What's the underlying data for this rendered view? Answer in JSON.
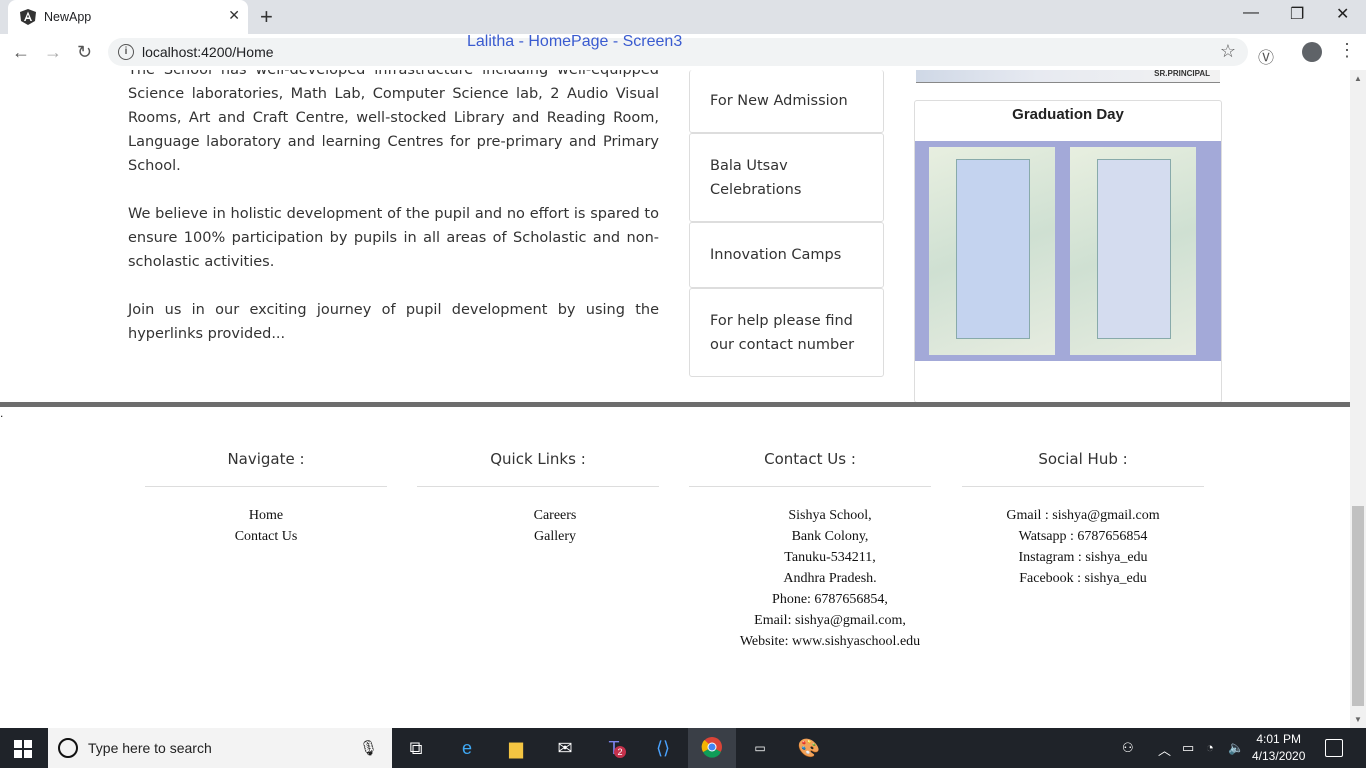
{
  "browser": {
    "tab_title": "NewApp",
    "tab_close": "✕",
    "new_tab": "+",
    "url": "localhost:4200/Home",
    "overlay_title": "Lalitha - HomePage - Screen3"
  },
  "intro": {
    "paragraphs": [
      "The School has well-developed infrastructure including well-equipped Science laboratories, Math Lab, Computer Science lab, 2 Audio Visual Rooms, Art and Craft Centre, well-stocked Library and Reading Room, Language laboratory and learning Centres for pre-primary and Primary School.",
      "We believe in holistic development of the pupil and no effort is spared to ensure 100% participation by pupils in all areas of Scholastic and non-scholastic activities.",
      "Join us in our exciting journey of pupil development by using the hyperlinks provided..."
    ]
  },
  "quick_cards": [
    {
      "label": "For New Admission"
    },
    {
      "label": "Bala Utsav Celebrations"
    },
    {
      "label": "Innovation Camps"
    },
    {
      "label": "For help please find our contact number"
    }
  ],
  "banner": {
    "text": "SR.PRINCIPAL"
  },
  "graduation": {
    "title": "Graduation Day"
  },
  "divider_dot": ".",
  "footer": {
    "navigate": {
      "heading": "Navigate :",
      "items": [
        "Home",
        "Contact Us"
      ]
    },
    "quick_links": {
      "heading": "Quick Links :",
      "items": [
        "Careers",
        "Gallery"
      ]
    },
    "contact": {
      "heading": "Contact Us :",
      "lines": [
        "Sishya School,",
        "Bank Colony,",
        "Tanuku-534211,",
        "Andhra Pradesh.",
        "Phone: 6787656854,",
        "Email: sishya@gmail.com,",
        "Website: www.sishyaschool.edu"
      ]
    },
    "social": {
      "heading": "Social Hub :",
      "lines": [
        "Gmail : sishya@gmail.com",
        "Watsapp : 6787656854",
        "Instagram : sishya_edu",
        "Facebook : sishya_edu"
      ]
    }
  },
  "taskbar": {
    "search_placeholder": "Type here to search",
    "time": "4:01 PM",
    "date": "4/13/2020",
    "teams_badge": "2"
  }
}
